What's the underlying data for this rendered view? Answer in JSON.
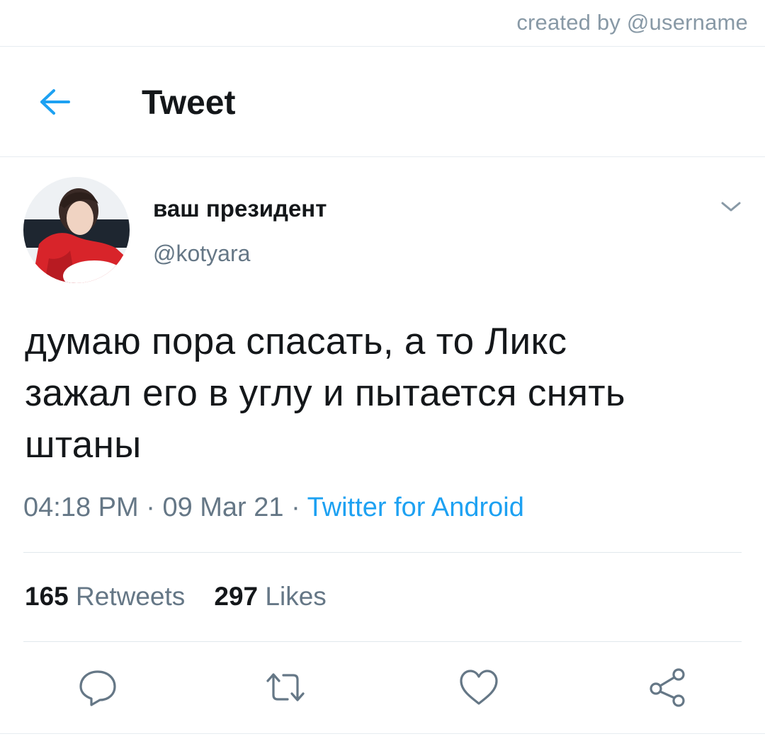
{
  "credit": "created by @username",
  "header": {
    "title": "Tweet",
    "back_icon": "arrow-left-icon"
  },
  "author": {
    "display_name": "ваш президент",
    "handle": "@kotyara",
    "menu_icon": "chevron-down-icon"
  },
  "tweet": {
    "text_lines": [
      "думаю пора спасать, а то Ликс",
      "зажал его в углу и пытается снять",
      "штаны"
    ],
    "time": "04:18 PM",
    "date": "09 Mar 21",
    "separator": " · ",
    "source": "Twitter for Android"
  },
  "stats": {
    "retweets_count": "165",
    "retweets_label": "Retweets",
    "likes_count": "297",
    "likes_label": "Likes"
  },
  "actions": [
    {
      "name": "reply",
      "icon": "reply-icon"
    },
    {
      "name": "retweet",
      "icon": "retweet-icon"
    },
    {
      "name": "like",
      "icon": "heart-icon"
    },
    {
      "name": "share",
      "icon": "share-icon"
    }
  ],
  "colors": {
    "accent": "#1da1f2",
    "text": "#14171a",
    "secondary": "#657786",
    "divider": "#e6ecf0"
  }
}
